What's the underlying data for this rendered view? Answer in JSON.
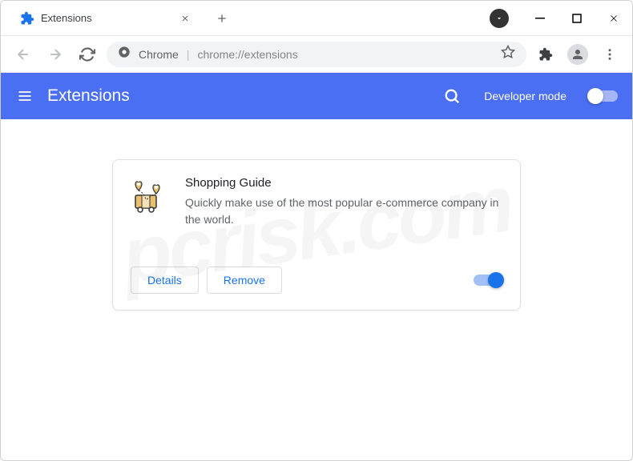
{
  "tab": {
    "title": "Extensions"
  },
  "omnibox": {
    "scheme": "Chrome",
    "path": "chrome://extensions"
  },
  "header": {
    "title": "Extensions",
    "dev_mode_label": "Developer mode"
  },
  "extension": {
    "name": "Shopping Guide",
    "description": "Quickly make use of the most popular e-commerce company in the world.",
    "details_label": "Details",
    "remove_label": "Remove",
    "enabled": true
  },
  "watermark": "pcrisk.com"
}
